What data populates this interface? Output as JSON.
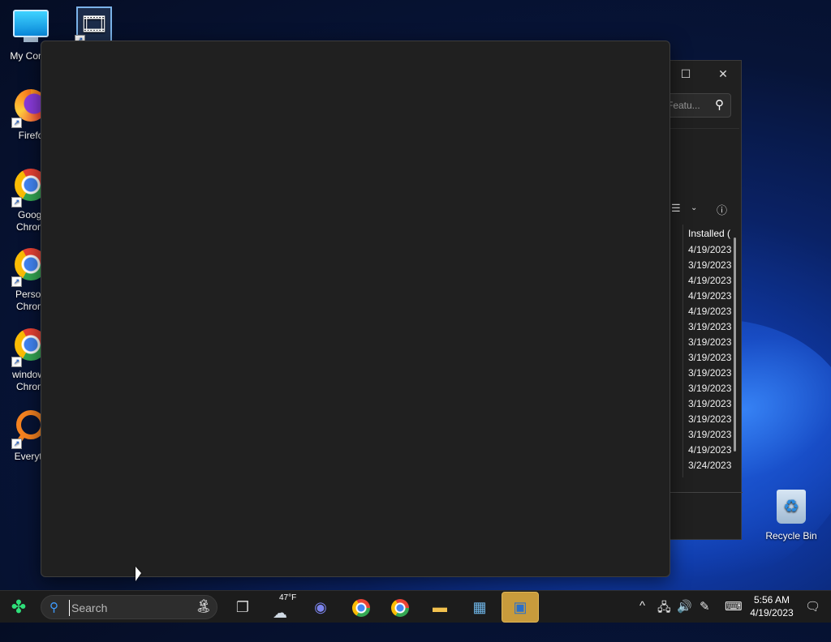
{
  "desktop": {
    "icons": [
      {
        "label": "My Comp",
        "icon": "computer-icon"
      },
      {
        "label": "",
        "icon": "film-icon"
      },
      {
        "label": "Firefo",
        "icon": "firefox-icon"
      },
      {
        "label": "Googl\nChrom",
        "icon": "chrome-icon"
      },
      {
        "label": "Person\nChrom",
        "icon": "chrome-profile-icon"
      },
      {
        "label": "windows\nChrom",
        "icon": "chrome-profile-icon"
      },
      {
        "label": "Everyth",
        "icon": "everything-search-icon"
      },
      {
        "label": "Recycle Bin",
        "icon": "recycle-bin-icon"
      }
    ]
  },
  "background_window": {
    "search_placeholder": "Featu...",
    "maximize_glyph": "☐",
    "close_glyph": "✕",
    "column_header": "Installed (",
    "installed_dates": [
      "4/19/2023",
      "3/19/2023",
      "4/19/2023",
      "4/19/2023",
      "4/19/2023",
      "3/19/2023",
      "3/19/2023",
      "3/19/2023",
      "3/19/2023",
      "3/19/2023",
      "3/19/2023",
      "3/19/2023",
      "3/19/2023",
      "4/19/2023",
      "3/24/2023"
    ]
  },
  "taskbar": {
    "search_placeholder": "Search",
    "weather_temp": "47°F",
    "clock_time": "5:56 AM",
    "clock_date": "4/19/2023",
    "apps": [
      "task-view-icon",
      "weather-icon",
      "meet-icon",
      "chrome-icon",
      "chrome-profile-icon",
      "file-explorer-icon",
      "resource-monitor-icon",
      "control-panel-icon"
    ]
  },
  "colors": {
    "window_bg": "#202020",
    "taskbar_bg": "#1c1c1c",
    "active_app_highlight": "#c89b3c",
    "accent": "#3f9cff"
  }
}
